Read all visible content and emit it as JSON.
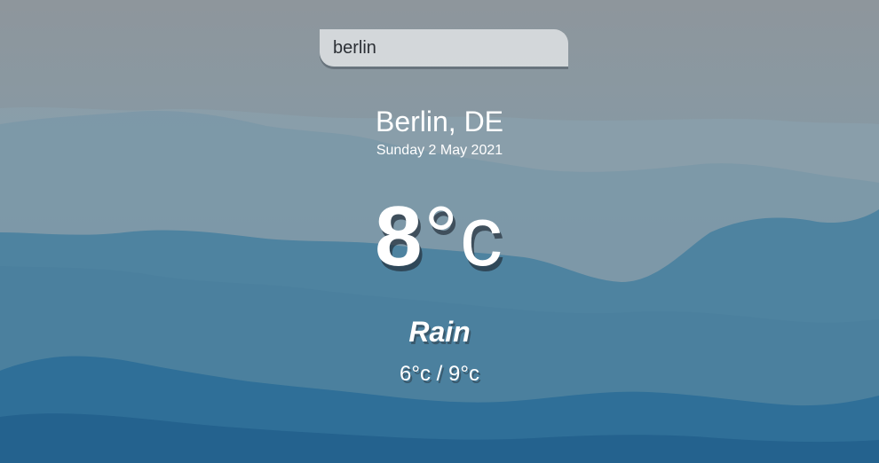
{
  "search": {
    "value": "berlin"
  },
  "location": {
    "city_country": "Berlin, DE",
    "date": "Sunday 2 May 2021"
  },
  "weather": {
    "temperature": "8",
    "unit": "°c",
    "condition": "Rain",
    "min_max": "6°c / 9°c"
  },
  "background": {
    "image": "misty-mountains",
    "sky_color": "#8e969c",
    "mountain_colors": [
      "#6f8a9a",
      "#4a7f9c",
      "#3a79a0",
      "#2a6a96",
      "#1e5f8e"
    ]
  }
}
